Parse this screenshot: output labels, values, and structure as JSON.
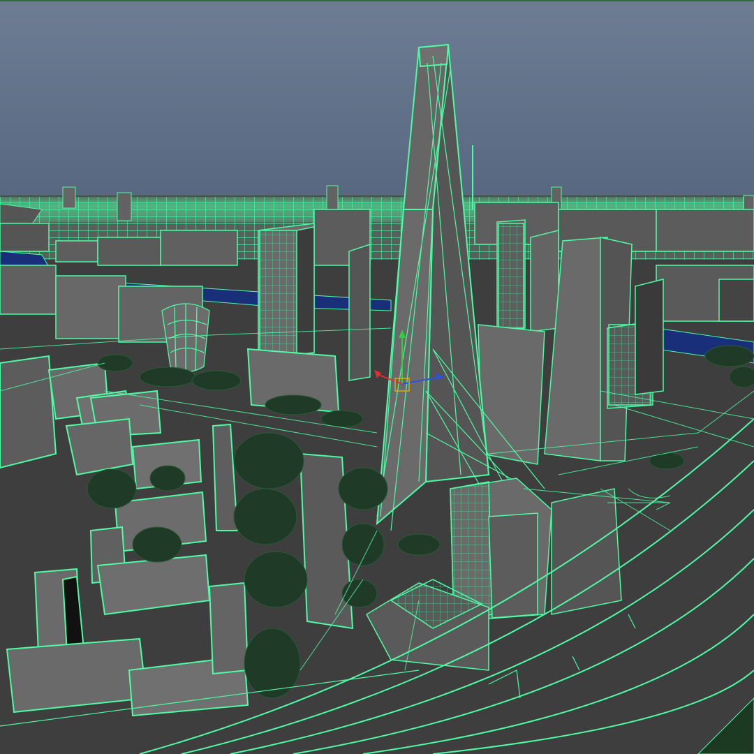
{
  "viewport": {
    "colors": {
      "sky_top": "#6e7d94",
      "sky_bottom": "#55667e",
      "ground": "#3e3e3e",
      "building_light": "#6a6a6a",
      "building_mid": "#545454",
      "building_dark": "#3a3a3a",
      "wireframe": "#4dfca4",
      "trees": "#1f3a27",
      "river": "#1a2f7a",
      "border": "#2f6b3a"
    },
    "manipulator": {
      "x_axis_color": "#e03030",
      "y_axis_color": "#30d040",
      "z_axis_color": "#3050e0",
      "center_color": "#d8b000"
    }
  }
}
